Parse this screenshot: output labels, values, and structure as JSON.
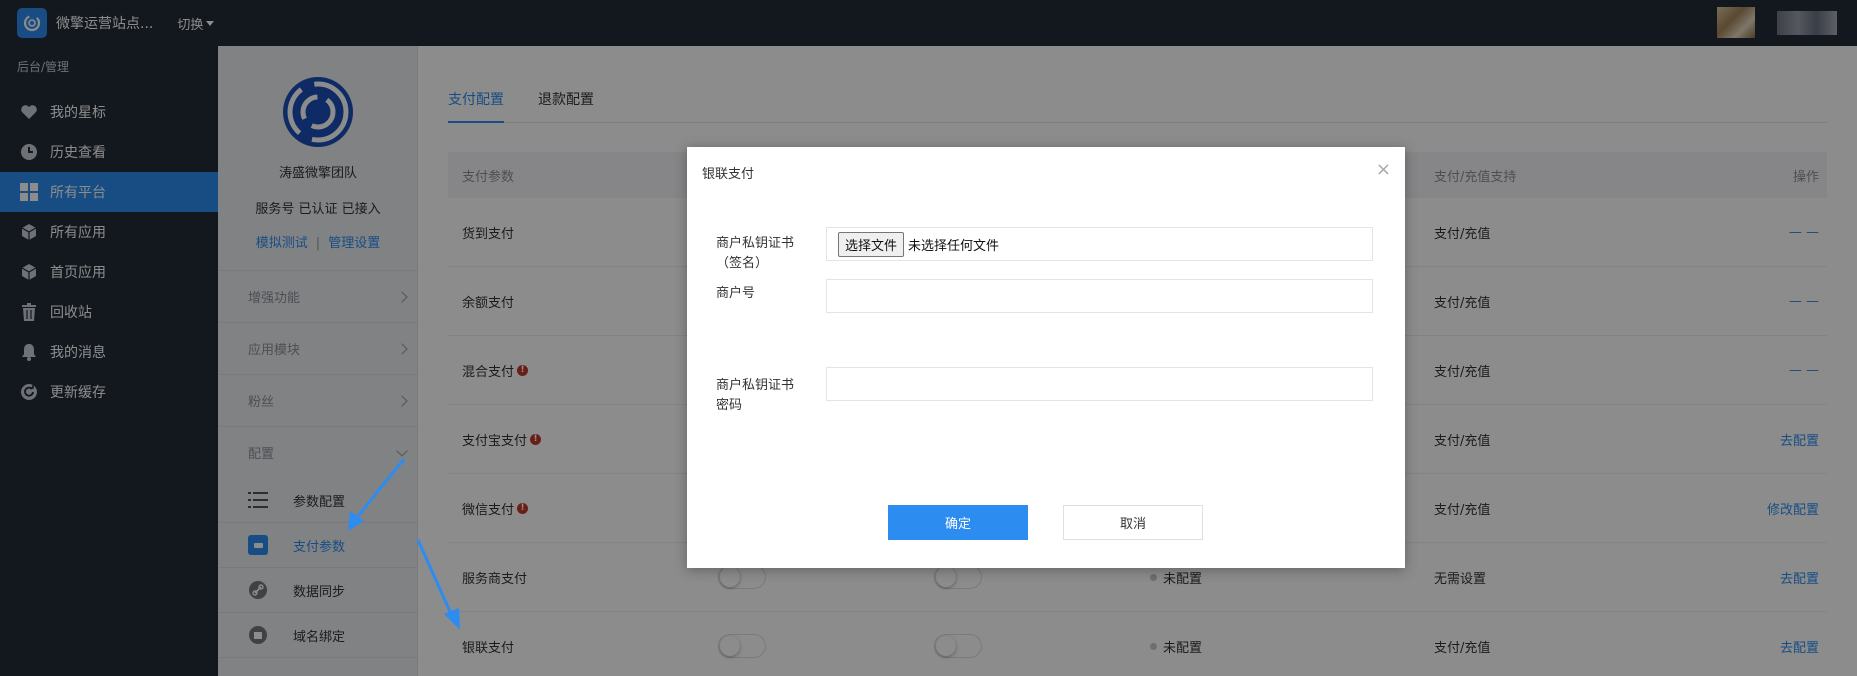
{
  "topbar": {
    "site_name": "微擎运营站点...",
    "switch_label": "切换"
  },
  "sidebar": {
    "section_label": "后台/管理",
    "items": [
      {
        "label": "我的星标",
        "icon": "heart-icon"
      },
      {
        "label": "历史查看",
        "icon": "clock-icon"
      },
      {
        "label": "所有平台",
        "icon": "grid-icon"
      },
      {
        "label": "所有应用",
        "icon": "cube-icon"
      },
      {
        "label": "首页应用",
        "icon": "cube-icon"
      },
      {
        "label": "回收站",
        "icon": "trash-icon"
      },
      {
        "label": "我的消息",
        "icon": "bell-icon"
      },
      {
        "label": "更新缓存",
        "icon": "refresh-icon"
      }
    ]
  },
  "account": {
    "name": "涛盛微擎团队",
    "status": "服务号 已认证 已接入",
    "link_test": "模拟测试",
    "link_divider": "|",
    "link_manage": "管理设置"
  },
  "submenu": {
    "groups": [
      {
        "label": "增强功能"
      },
      {
        "label": "应用模块"
      },
      {
        "label": "粉丝"
      },
      {
        "label": "配置"
      }
    ],
    "config_items": [
      {
        "label": "参数配置",
        "icon": "list-icon"
      },
      {
        "label": "支付参数",
        "icon": "wallet-icon"
      },
      {
        "label": "数据同步",
        "icon": "link-icon"
      },
      {
        "label": "域名绑定",
        "icon": "domain-icon"
      }
    ]
  },
  "tabs": [
    {
      "label": "支付配置"
    },
    {
      "label": "退款配置"
    }
  ],
  "table": {
    "headers": {
      "name": "支付参数",
      "support": "支付/充值支持",
      "op": "操作"
    },
    "rows": [
      {
        "name": "货到支付",
        "info": false,
        "status": "",
        "support": "支付/充值",
        "op": "— —"
      },
      {
        "name": "余额支付",
        "info": false,
        "status": "",
        "support": "支付/充值",
        "op": "— —"
      },
      {
        "name": "混合支付",
        "info": true,
        "status": "",
        "support": "支付/充值",
        "op": "— —"
      },
      {
        "name": "支付宝支付",
        "info": true,
        "status": "",
        "support": "支付/充值",
        "op": "去配置"
      },
      {
        "name": "微信支付",
        "info": true,
        "status": "",
        "support": "支付/充值",
        "op": "修改配置"
      },
      {
        "name": "服务商支付",
        "info": false,
        "status": "未配置",
        "support": "无需设置",
        "op": "去配置"
      },
      {
        "name": "银联支付",
        "info": false,
        "status": "未配置",
        "support": "支付/充值",
        "op": "去配置"
      }
    ]
  },
  "dialog": {
    "title": "银联支付",
    "close": "×",
    "field_cert_label": "商户私钥证书（签名）",
    "file_button": "选择文件",
    "file_none": "未选择任何文件",
    "field_merchant_label": "商户号",
    "field_merchant_value": "",
    "field_password_label": "商户私钥证书密码",
    "field_password_value": "",
    "ok": "确定",
    "cancel": "取消"
  },
  "colors": {
    "primary": "#2d8cf0",
    "topbar_bg": "#232b37",
    "info_red": "#c0392b"
  }
}
